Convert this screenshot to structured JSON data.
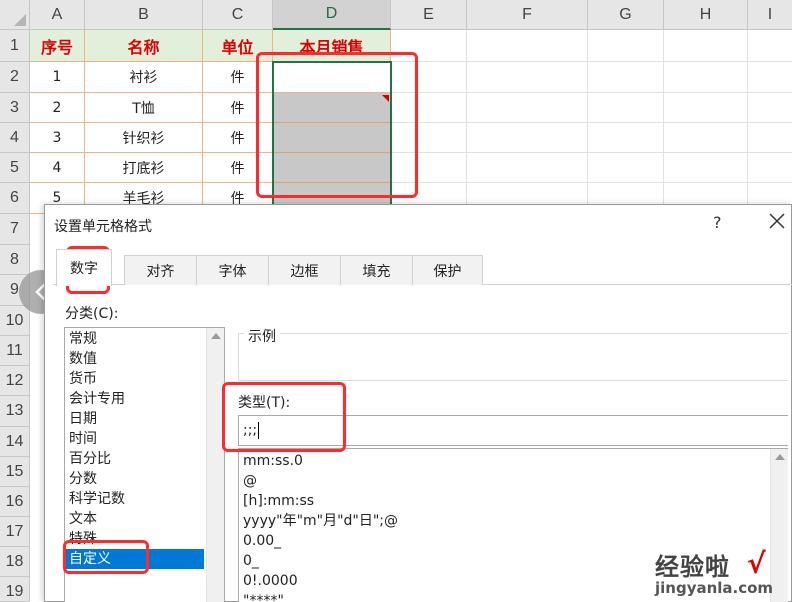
{
  "sheet": {
    "columns": [
      "A",
      "B",
      "C",
      "D",
      "E",
      "F",
      "G",
      "H",
      "I"
    ],
    "rows": [
      "1",
      "2",
      "3",
      "4",
      "5",
      "6",
      "7",
      "8",
      "9",
      "10",
      "11",
      "12",
      "13",
      "14",
      "15",
      "16",
      "17",
      "18",
      "19"
    ],
    "header": {
      "seq": "序号",
      "name": "名称",
      "unit": "单位",
      "sales": "本月销售"
    },
    "data": [
      {
        "seq": "1",
        "name": "衬衫",
        "unit": "件"
      },
      {
        "seq": "2",
        "name": "T恤",
        "unit": "件"
      },
      {
        "seq": "3",
        "name": "针织衫",
        "unit": "件"
      },
      {
        "seq": "4",
        "name": "打底衫",
        "unit": "件"
      },
      {
        "seq": "5",
        "name": "羊毛衫",
        "unit": "件"
      }
    ]
  },
  "dialog": {
    "title": "设置单元格格式",
    "help": "?",
    "tabs": [
      "数字",
      "对齐",
      "字体",
      "边框",
      "填充",
      "保护"
    ],
    "category_label": "分类(C):",
    "categories": [
      "常规",
      "数值",
      "货币",
      "会计专用",
      "日期",
      "时间",
      "百分比",
      "分数",
      "科学记数",
      "文本",
      "特殊",
      "自定义"
    ],
    "selected_category": "自定义",
    "sample_label": "示例",
    "type_label": "类型(T):",
    "type_value": ";;;",
    "format_list": [
      "mm:ss.0",
      "@",
      "[h]:mm:ss",
      "yyyy\"年\"m\"月\"d\"日\";@",
      "0.00_",
      "0_",
      "0!.0000",
      "\"****\""
    ]
  },
  "watermark": {
    "cn": "经验啦",
    "check": "√",
    "en": "jingyanla.com"
  },
  "colors": {
    "highlight": "#ff2a2a",
    "header_fill": "#e2efda",
    "header_text": "#e00000",
    "selection": "#0078d7"
  }
}
